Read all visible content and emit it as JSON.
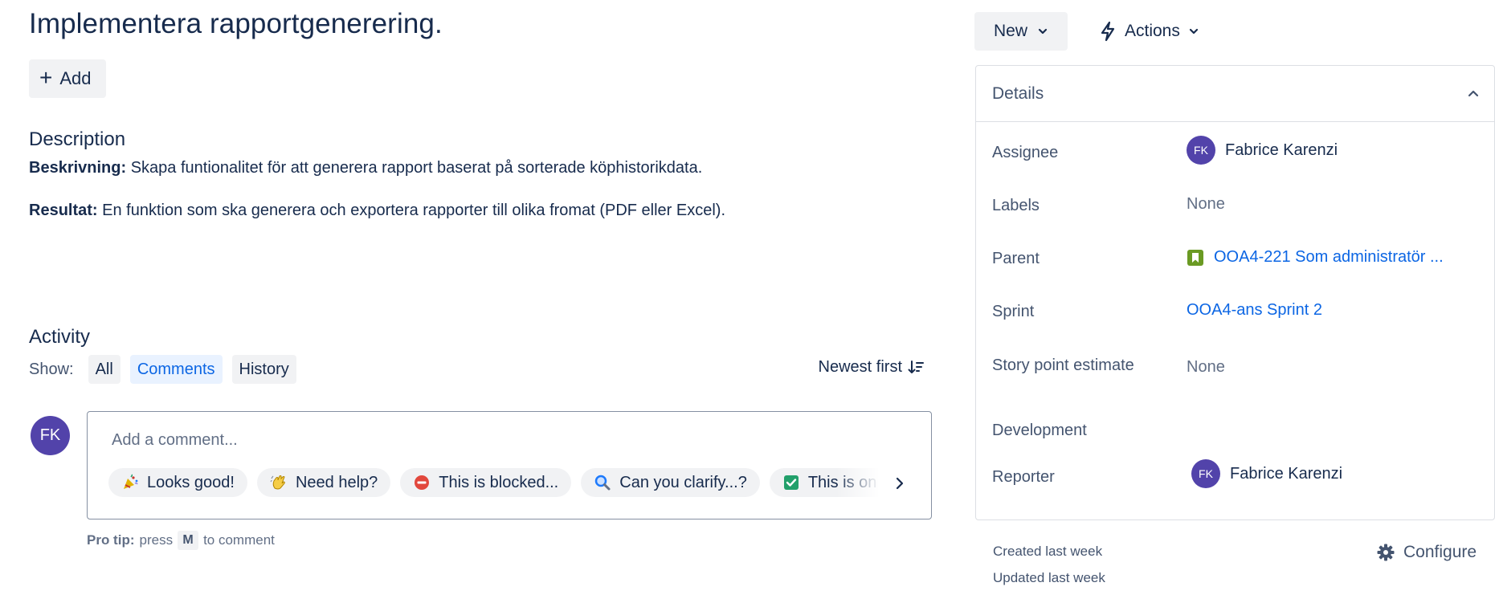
{
  "issue": {
    "title": "Implementera rapportgenerering.",
    "add_label": "Add"
  },
  "description": {
    "heading": "Description",
    "line1_label": "Beskrivning:",
    "line1_text": " Skapa funtionalitet för att generera rapport baserat på sorterade köphistorikdata.",
    "line2_label": "Resultat:",
    "line2_text": " En funktion som ska generera och exportera rapporter till olika fromat (PDF eller Excel)."
  },
  "activity": {
    "heading": "Activity",
    "show_label": "Show:",
    "filters": [
      "All",
      "Comments",
      "History"
    ],
    "active_filter": "Comments",
    "sort_label": "Newest first",
    "user_initials": "FK",
    "comment_placeholder": "Add a comment...",
    "quick_replies": [
      {
        "icon": "party-popper-icon",
        "label": "Looks good!"
      },
      {
        "icon": "waving-hand-icon",
        "label": "Need help?"
      },
      {
        "icon": "no-entry-icon",
        "label": "This is blocked..."
      },
      {
        "icon": "magnifier-icon",
        "label": "Can you clarify...?"
      },
      {
        "icon": "check-box-icon",
        "label": "This is on track"
      }
    ],
    "protip_bold": "Pro tip:",
    "protip_press": "press",
    "protip_key": "M",
    "protip_rest": "to comment"
  },
  "toolbar": {
    "status_label": "New",
    "actions_label": "Actions"
  },
  "details": {
    "title": "Details",
    "assignee_label": "Assignee",
    "assignee_initials": "FK",
    "assignee_name": "Fabrice Karenzi",
    "labels_label": "Labels",
    "labels_value": "None",
    "parent_label": "Parent",
    "parent_value": "OOA4-221 Som administratör ...",
    "sprint_label": "Sprint",
    "sprint_value": "OOA4-ans Sprint 2",
    "story_points_label": "Story point estimate",
    "story_points_value": "None",
    "development_label": "Development",
    "reporter_label": "Reporter",
    "reporter_initials": "FK",
    "reporter_name": "Fabrice Karenzi"
  },
  "meta": {
    "created": "Created last week",
    "updated": "Updated last week",
    "configure_label": "Configure"
  },
  "colors": {
    "text": "#172b4d",
    "subtle": "#44546f",
    "link": "#0c66e4",
    "avatar": "#5243aa",
    "neutral_bg": "#f1f2f4",
    "selected_bg": "#e9f2ff",
    "parent_badge": "#6a9a23"
  }
}
